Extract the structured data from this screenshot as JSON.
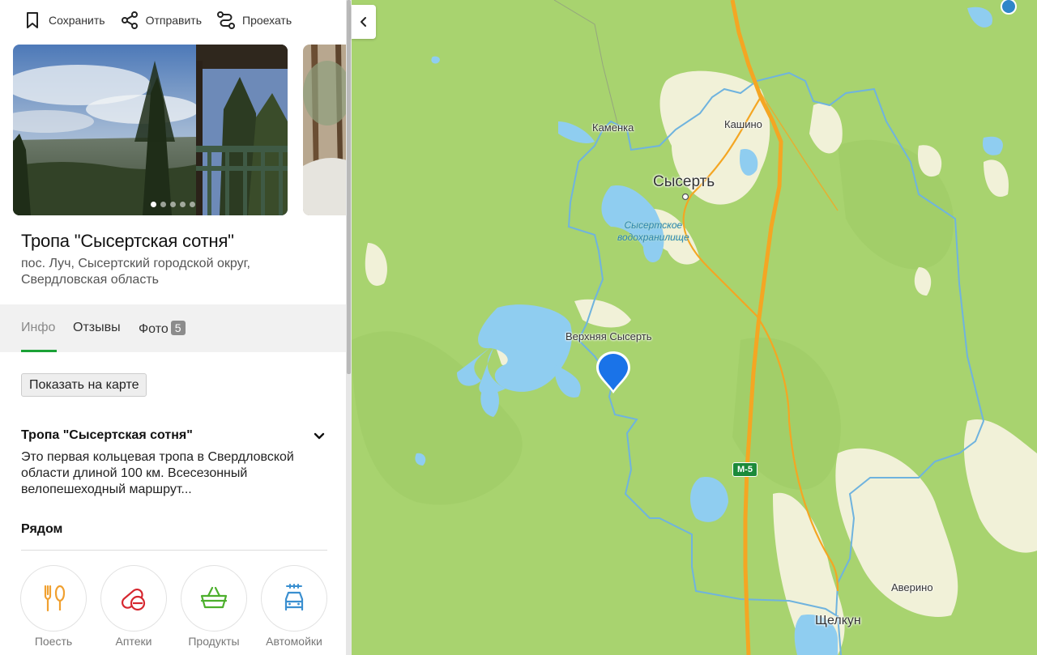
{
  "actions": {
    "save": "Сохранить",
    "share": "Отправить",
    "route": "Проехать"
  },
  "gallery": {
    "photo_count_dots": 5,
    "active_dot": 1
  },
  "place": {
    "title": "Тропа \"Сысертская сотня\"",
    "address": "пос. Луч, Сысертский городской округ, Свердловская область"
  },
  "tabs": [
    {
      "label": "Инфо",
      "active": true
    },
    {
      "label": "Отзывы",
      "active": false
    },
    {
      "label": "Фото",
      "active": false,
      "badge": "5"
    }
  ],
  "show_on_map": "Показать на карте",
  "description": {
    "title": "Тропа \"Сысертская сотня\"",
    "text": "Это первая кольцевая тропа в Свердловской области длиной 100 км. Всесезонный велопешеходный маршрут..."
  },
  "nearby": {
    "title": "Рядом",
    "categories": [
      {
        "label": "Поесть",
        "icon": "fork-knife-icon",
        "color": "#f0a030"
      },
      {
        "label": "Аптеки",
        "icon": "pills-icon",
        "color": "#d6272f"
      },
      {
        "label": "Продукты",
        "icon": "basket-icon",
        "color": "#4caf2c"
      },
      {
        "label": "Автомойки",
        "icon": "car-wash-icon",
        "color": "#3a8fd0"
      }
    ]
  },
  "map": {
    "labels": {
      "kamenka": "Каменка",
      "kashino": "Кашино",
      "sysert": "Сысерть",
      "reservoir_line1": "Сысертское",
      "reservoir_line2": "водохранилище",
      "verkhnyaya": "Верхняя Сысерть",
      "averino": "Аверино",
      "shchelkun": "Щелкун",
      "road": "М-5"
    },
    "colors": {
      "forest": "#a8d36f",
      "light_field": "#f1f1d8",
      "water": "#8fcdf0",
      "trail": "#6fb3de",
      "highway": "#f4a623",
      "marker": "#1a73e8"
    }
  }
}
